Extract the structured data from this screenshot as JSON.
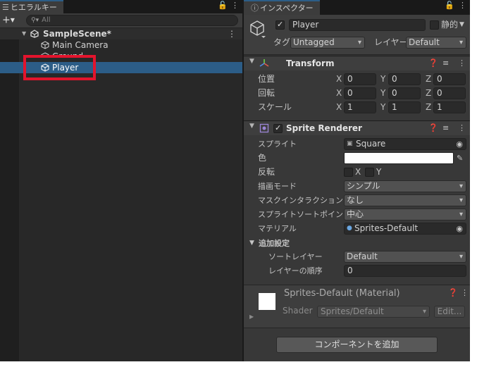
{
  "hierarchy": {
    "tab_label": "ヒエラルキー",
    "search_placeholder": "All",
    "add_button": "+",
    "scene": "SampleScene*",
    "items": [
      {
        "label": "Main Camera"
      },
      {
        "label": "Ground"
      },
      {
        "label": "Player"
      }
    ]
  },
  "inspector": {
    "tab_label": "インスペクター",
    "object_name": "Player",
    "static_label": "静的",
    "tag_label": "タグ",
    "tag_value": "Untagged",
    "layer_label": "レイヤー",
    "layer_value": "Default",
    "transform": {
      "title": "Transform",
      "position_label": "位置",
      "rotation_label": "回転",
      "scale_label": "スケール",
      "axes": [
        "X",
        "Y",
        "Z"
      ],
      "position": [
        "0",
        "0",
        "0"
      ],
      "rotation": [
        "0",
        "0",
        "0"
      ],
      "scale": [
        "1",
        "1",
        "1"
      ]
    },
    "sprite_renderer": {
      "title": "Sprite Renderer",
      "sprite_label": "スプライト",
      "sprite_value": "Square",
      "color_label": "色",
      "color_value": "#ffffff",
      "flip_label": "反転",
      "flip_x": "X",
      "flip_y": "Y",
      "draw_mode_label": "描画モード",
      "draw_mode_value": "シンプル",
      "mask_label": "マスクインタラクション",
      "mask_value": "なし",
      "sort_point_label": "スプライトソートポイント",
      "sort_point_value": "中心",
      "material_label": "マテリアル",
      "material_value": "Sprites-Default",
      "additional_label": "追加設定",
      "sorting_layer_label": "ソートレイヤー",
      "sorting_layer_value": "Default",
      "order_label": "レイヤーの順序",
      "order_value": "0"
    },
    "material": {
      "title": "Sprites-Default (Material)",
      "shader_label": "Shader",
      "shader_value": "Sprites/Default",
      "edit_label": "Edit..."
    },
    "add_component_label": "コンポーネントを追加"
  },
  "colors": {
    "selection": "#2c5d87",
    "highlight_box": "#e3142d"
  }
}
